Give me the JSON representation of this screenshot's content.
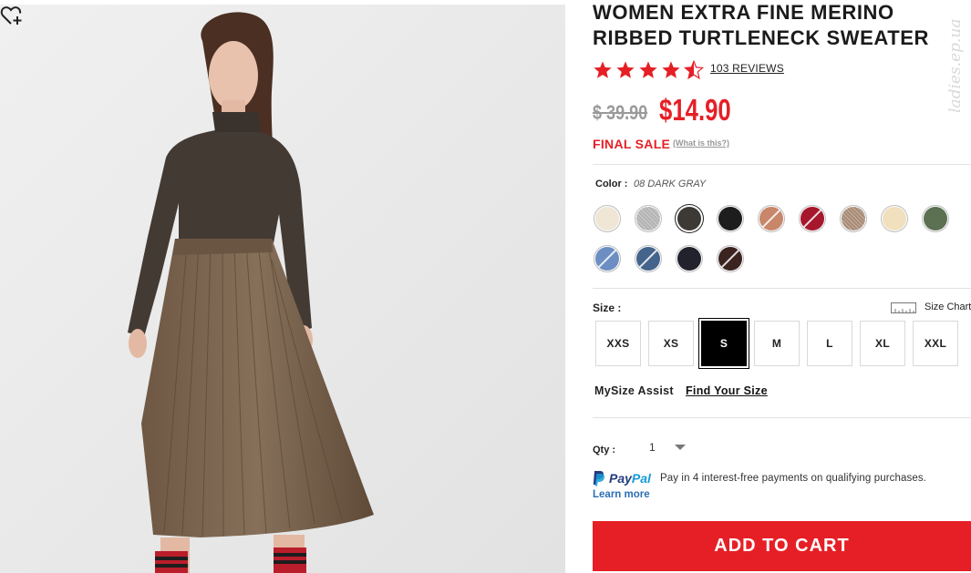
{
  "product": {
    "title_line1": "WOMEN EXTRA FINE MERINO",
    "title_line2": "RIBBED TURTLENECK SWEATER",
    "watermark": "ladies.ep.ua",
    "rating": 4.5,
    "rating_max": 5,
    "reviews_label": "103 REVIEWS",
    "original_price": "$ 39.90",
    "sale_price": "$14.90",
    "final_sale_label": "FINAL SALE",
    "what_is_this_label": "(What is this?)",
    "favorite_icon": "heart-plus-icon"
  },
  "color": {
    "label": "Color :",
    "selected_value": "08 DARK GRAY",
    "swatches": [
      {
        "name": "off-white",
        "hex": "#efe6d6",
        "pattern": "solid"
      },
      {
        "name": "light-gray",
        "hex": "#b3b3b3",
        "pattern": "heather"
      },
      {
        "name": "dark-gray",
        "hex": "#3d3a36",
        "pattern": "solid",
        "selected": true
      },
      {
        "name": "black",
        "hex": "#1d1d1d",
        "pattern": "solid"
      },
      {
        "name": "orange",
        "hex": "#c8866a",
        "pattern": "slash"
      },
      {
        "name": "red",
        "hex": "#a6172d",
        "pattern": "slash"
      },
      {
        "name": "brown-heather",
        "hex": "#a88b75",
        "pattern": "heather"
      },
      {
        "name": "cream",
        "hex": "#f1e0bd",
        "pattern": "solid"
      },
      {
        "name": "olive",
        "hex": "#5b7152",
        "pattern": "solid"
      },
      {
        "name": "blue",
        "hex": "#6c8ec2",
        "pattern": "slash"
      },
      {
        "name": "navy-blue",
        "hex": "#45648c",
        "pattern": "slash"
      },
      {
        "name": "navy",
        "hex": "#22222c",
        "pattern": "solid"
      },
      {
        "name": "dark-brown",
        "hex": "#3b2320",
        "pattern": "slash"
      }
    ]
  },
  "size": {
    "label": "Size :",
    "chart_label": "Size Chart",
    "chart_icon": "ruler-icon",
    "options": [
      "XXS",
      "XS",
      "S",
      "M",
      "L",
      "XL",
      "XXL"
    ],
    "selected": "S",
    "mysize_label": "MySize Assist",
    "find_size_label": "Find Your Size"
  },
  "quantity": {
    "label": "Qty :",
    "value": "1"
  },
  "paypal": {
    "brand_pay": "Pay",
    "brand_pal": "Pal",
    "message": "Pay in 4 interest-free payments on qualifying purchases.",
    "learn_more": "Learn more"
  },
  "cart": {
    "button_label": "ADD TO CART"
  },
  "colors": {
    "accent_red": "#e61f26",
    "paypal_dark": "#253b80",
    "paypal_light": "#179bd7",
    "link_blue": "#2b6fb6"
  }
}
